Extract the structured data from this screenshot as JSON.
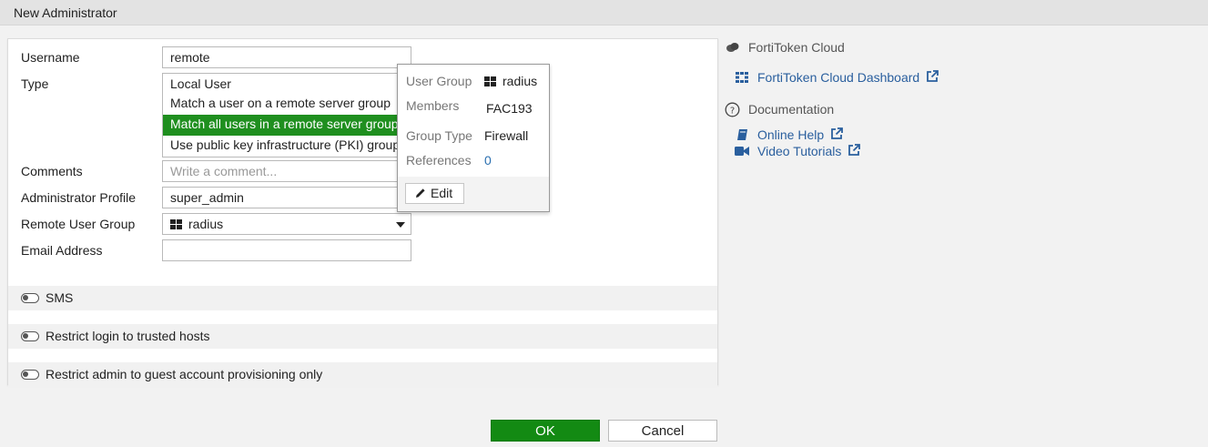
{
  "window": {
    "title": "New Administrator"
  },
  "form": {
    "username_label": "Username",
    "username_value": "remote",
    "type_label": "Type",
    "type_selected": "Local User",
    "type_options": [
      "Match a user on a remote server group",
      "Match all users in a remote server group",
      "Use public key infrastructure (PKI) group"
    ],
    "type_highlighted_index": 1,
    "comments_label": "Comments",
    "comments_placeholder": "Write a comment...",
    "admin_profile_label": "Administrator Profile",
    "admin_profile_value": "super_admin",
    "remote_group_label": "Remote User Group",
    "remote_group_value": "radius",
    "email_label": "Email Address",
    "email_value": ""
  },
  "sections": {
    "sms": "SMS",
    "trusted_hosts": "Restrict login to trusted hosts",
    "guest_only": "Restrict admin to guest account provisioning only"
  },
  "popup": {
    "user_group_key": "User Group",
    "user_group_value": "radius",
    "members_key": "Members",
    "members_value": "FAC193",
    "group_type_key": "Group Type",
    "group_type_value": "Firewall",
    "references_key": "References",
    "references_value": "0",
    "edit_label": "Edit"
  },
  "sidebar": {
    "fortitoken_title": "FortiToken Cloud",
    "fortitoken_dashboard": "FortiToken Cloud Dashboard",
    "documentation_title": "Documentation",
    "online_help": "Online Help",
    "video_tutorials": "Video Tutorials"
  },
  "buttons": {
    "ok": "OK",
    "cancel": "Cancel"
  },
  "colors": {
    "accent_green": "#138a13",
    "link_blue": "#2a5f9e"
  }
}
